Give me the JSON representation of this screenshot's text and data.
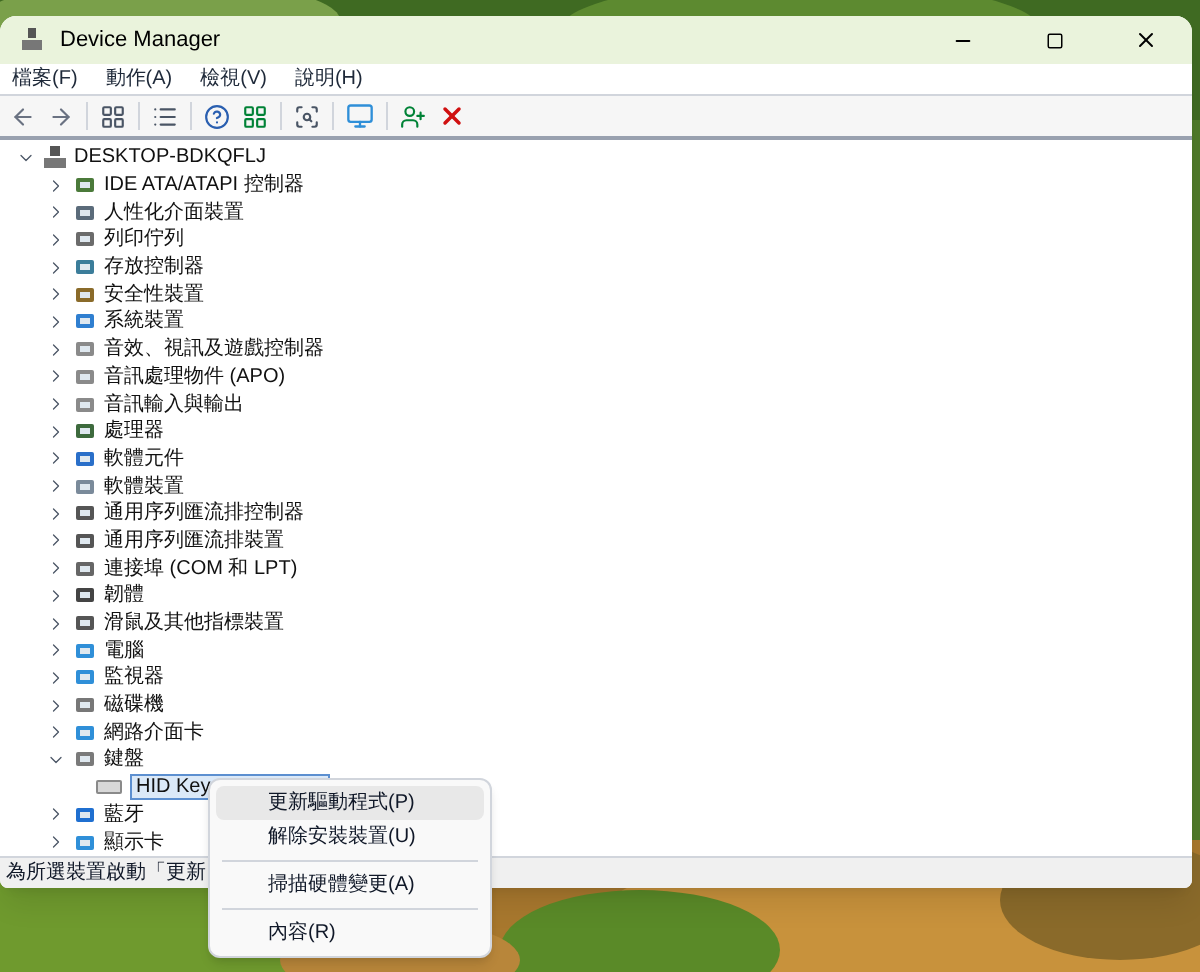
{
  "window": {
    "title": "Device Manager"
  },
  "menu_bar": [
    "檔案(F)",
    "動作(A)",
    "檢視(V)",
    "說明(H)"
  ],
  "tree": {
    "label": "DESKTOP-BDKQFLJ",
    "expanded": true,
    "children": [
      {
        "label": "IDE ATA/ATAPI 控制器",
        "expanded": false
      },
      {
        "label": "人性化介面裝置",
        "expanded": false
      },
      {
        "label": "列印佇列",
        "expanded": false
      },
      {
        "label": "存放控制器",
        "expanded": false
      },
      {
        "label": "安全性裝置",
        "expanded": false
      },
      {
        "label": "系統裝置",
        "expanded": false
      },
      {
        "label": "音效、視訊及遊戲控制器",
        "expanded": false
      },
      {
        "label": "音訊處理物件 (APO)",
        "expanded": false
      },
      {
        "label": "音訊輸入與輸出",
        "expanded": false
      },
      {
        "label": "處理器",
        "expanded": false
      },
      {
        "label": "軟體元件",
        "expanded": false
      },
      {
        "label": "軟體裝置",
        "expanded": false
      },
      {
        "label": "通用序列匯流排控制器",
        "expanded": false
      },
      {
        "label": "通用序列匯流排裝置",
        "expanded": false
      },
      {
        "label": "連接埠 (COM 和 LPT)",
        "expanded": false
      },
      {
        "label": "韌體",
        "expanded": false
      },
      {
        "label": "滑鼠及其他指標裝置",
        "expanded": false
      },
      {
        "label": "電腦",
        "expanded": false
      },
      {
        "label": "監視器",
        "expanded": false
      },
      {
        "label": "磁碟機",
        "expanded": false
      },
      {
        "label": "網路介面卡",
        "expanded": false
      },
      {
        "label": "鍵盤",
        "expanded": true,
        "children": [
          {
            "label": "HID Key",
            "selected": true
          }
        ]
      },
      {
        "label": "藍牙",
        "expanded": false
      },
      {
        "label": "顯示卡",
        "expanded": false
      }
    ]
  },
  "status_bar": "為所選裝置啟動「更新",
  "context_menu": [
    {
      "kind": "item",
      "label": "更新驅動程式(P)",
      "selected": true
    },
    {
      "kind": "item",
      "label": "解除安裝裝置(U)",
      "selected": false
    },
    {
      "kind": "separator"
    },
    {
      "kind": "item",
      "label": "掃描硬體變更(A)",
      "selected": false
    },
    {
      "kind": "separator"
    },
    {
      "kind": "item",
      "label": "內容(R)",
      "selected": false
    }
  ]
}
